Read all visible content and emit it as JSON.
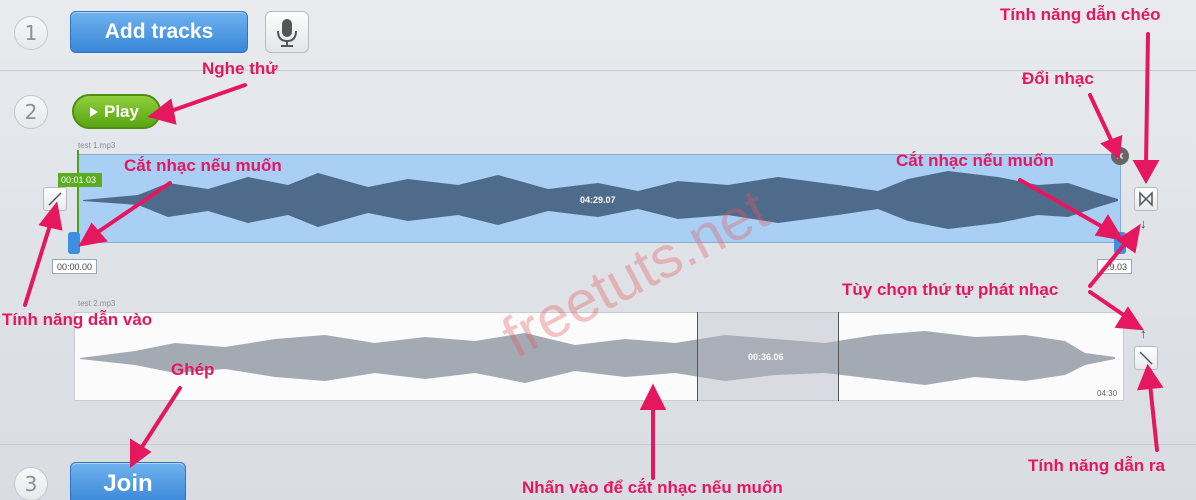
{
  "steps": {
    "one": "1",
    "two": "2",
    "three": "3"
  },
  "buttons": {
    "add_tracks": "Add tracks",
    "play": "Play",
    "join": "Join"
  },
  "icons": {
    "microphone": "microphone-icon",
    "play": "play-triangle-icon",
    "close": "close-icon",
    "crossfade": "bowtie-icon",
    "fade_in": "diagonal-up-icon",
    "fade_out": "diagonal-down-icon",
    "arrow_down": "arrow-down-icon",
    "arrow_up": "arrow-up-icon"
  },
  "track1": {
    "file": "test 1.mp3",
    "start_green": "00:01.03",
    "length": "04:29.07",
    "start_time": "00:00.00",
    "end_time": "...9.03",
    "color": "#a9cff5"
  },
  "track2": {
    "file": "test 2.mp3",
    "selection": "00:36.06",
    "total": "04:30"
  },
  "annotations": {
    "nghe_thu": "Nghe thử",
    "cat_nhac_left": "Cắt nhạc nếu muốn",
    "cat_nhac_right": "Cắt nhạc nếu muốn",
    "tinh_nang_dan_cheo": "Tính năng dẫn chéo",
    "doi_nhac": "Đổi nhạc",
    "tuy_chon": "Tùy chọn thứ tự phát nhạc",
    "tinh_nang_dan_vao": "Tính năng dẫn vào",
    "ghep": "Ghép",
    "nhan_vao": "Nhấn vào để cắt nhạc nếu muốn",
    "tinh_nang_dan_ra": "Tính năng dẫn ra"
  },
  "watermark": "freetuts.net",
  "colors": {
    "annotation": "#e5175f",
    "button_blue": "#3886d8",
    "button_green": "#5aa512"
  }
}
